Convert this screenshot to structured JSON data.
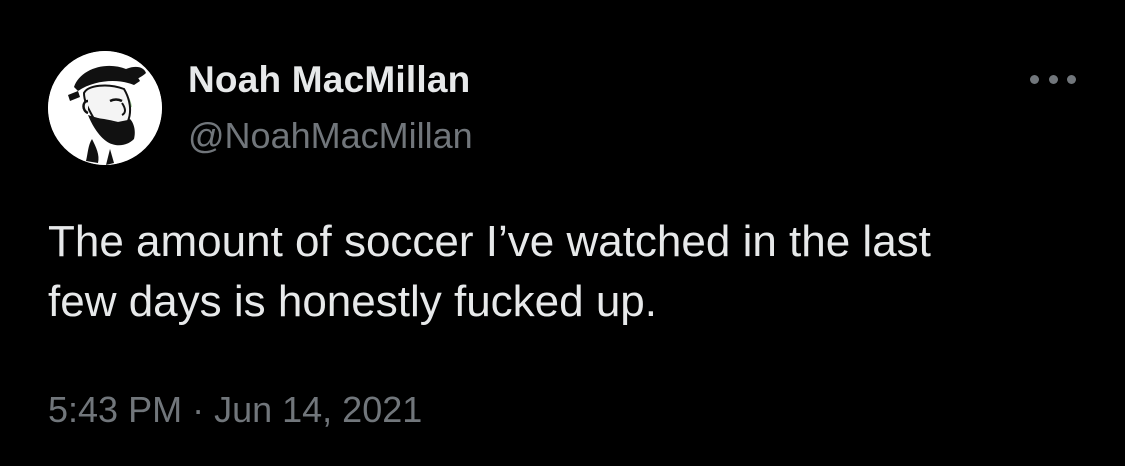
{
  "author": {
    "display_name": "Noah MacMillan",
    "handle": "@NoahMacMillan",
    "avatar_icon": "bearded-man-cap-avatar"
  },
  "menu": {
    "icon": "more-options-icon"
  },
  "tweet": {
    "text": "The amount of soccer I’ve watched in the last\nfew days is honestly fucked up."
  },
  "meta": {
    "time": "5:43 PM",
    "separator": "·",
    "date": "Jun 14, 2021"
  },
  "colors": {
    "background": "#000000",
    "primary_text": "#e7e9ea",
    "secondary_text": "#71767b"
  }
}
